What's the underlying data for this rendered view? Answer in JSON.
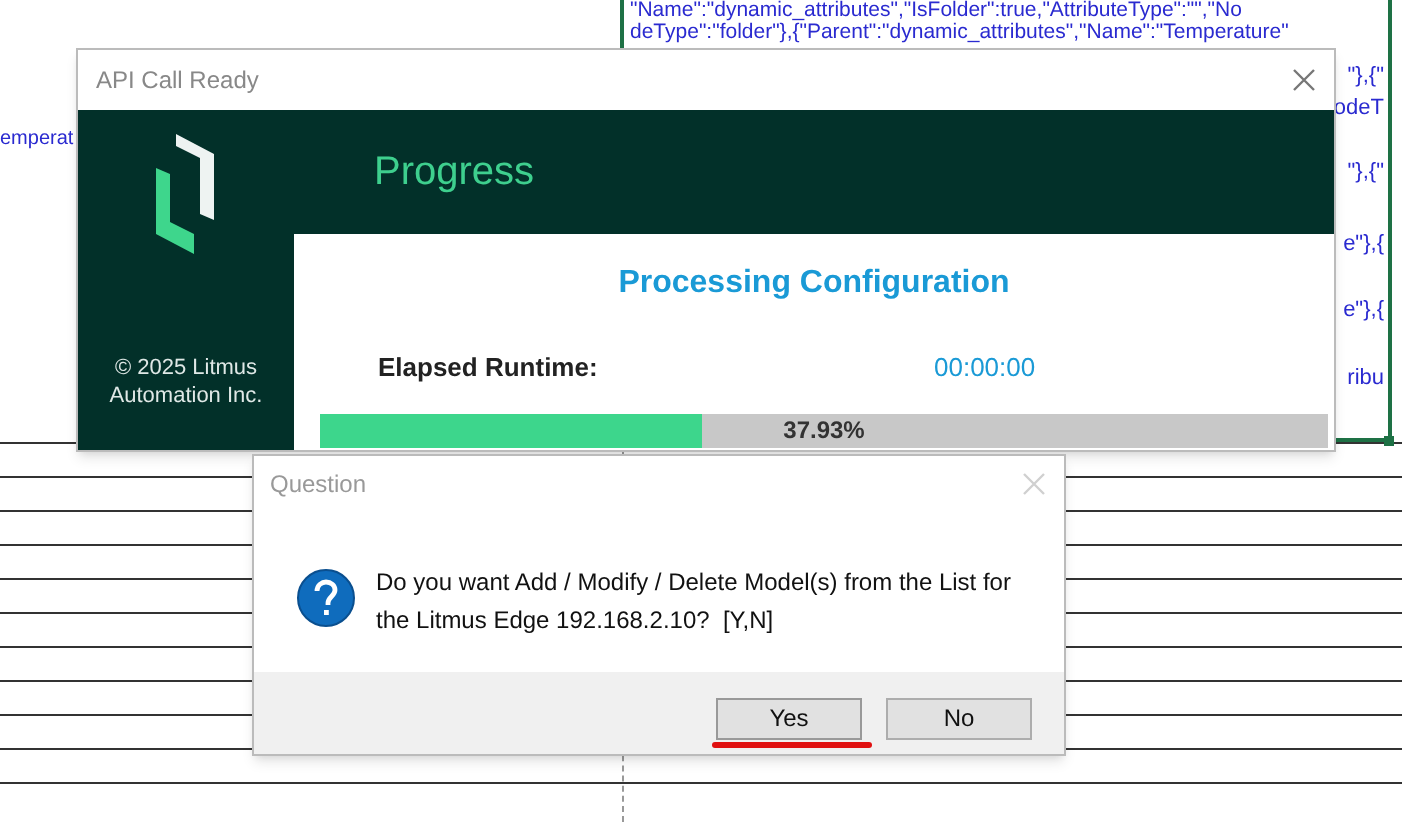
{
  "spreadsheet": {
    "cell_lines": [
      "\"Name\":\"dynamic_attributes\",\"IsFolder\":true,\"AttributeType\":\"\",\"No",
      "deType\":\"folder\"},{\"Parent\":\"dynamic_attributes\",\"Name\":\"Temperature\""
    ],
    "cell_fragments": [
      "\"},{\"",
      "odeT",
      "\"},{\"",
      "e\"},{",
      "e\"},{",
      "ribu"
    ],
    "left_fragment": "emperat"
  },
  "progress_window": {
    "title": "API Call Ready",
    "heading": "Progress",
    "copyright": "© 2025 Litmus Automation Inc.",
    "subheading": "Processing Configuration",
    "elapsed_label": "Elapsed Runtime:",
    "elapsed_value": "00:00:00",
    "progress": {
      "level": 0.3793,
      "reading": "37.93%"
    }
  },
  "question_dialog": {
    "title": "Question",
    "message": "Do you want Add / Modify / Delete Model(s) from the List for the Litmus Edge 192.168.2.10?  [Y,N]",
    "buttons": [
      {
        "label": "Yes",
        "selected": true
      },
      {
        "label": "No",
        "selected": false
      }
    ]
  }
}
